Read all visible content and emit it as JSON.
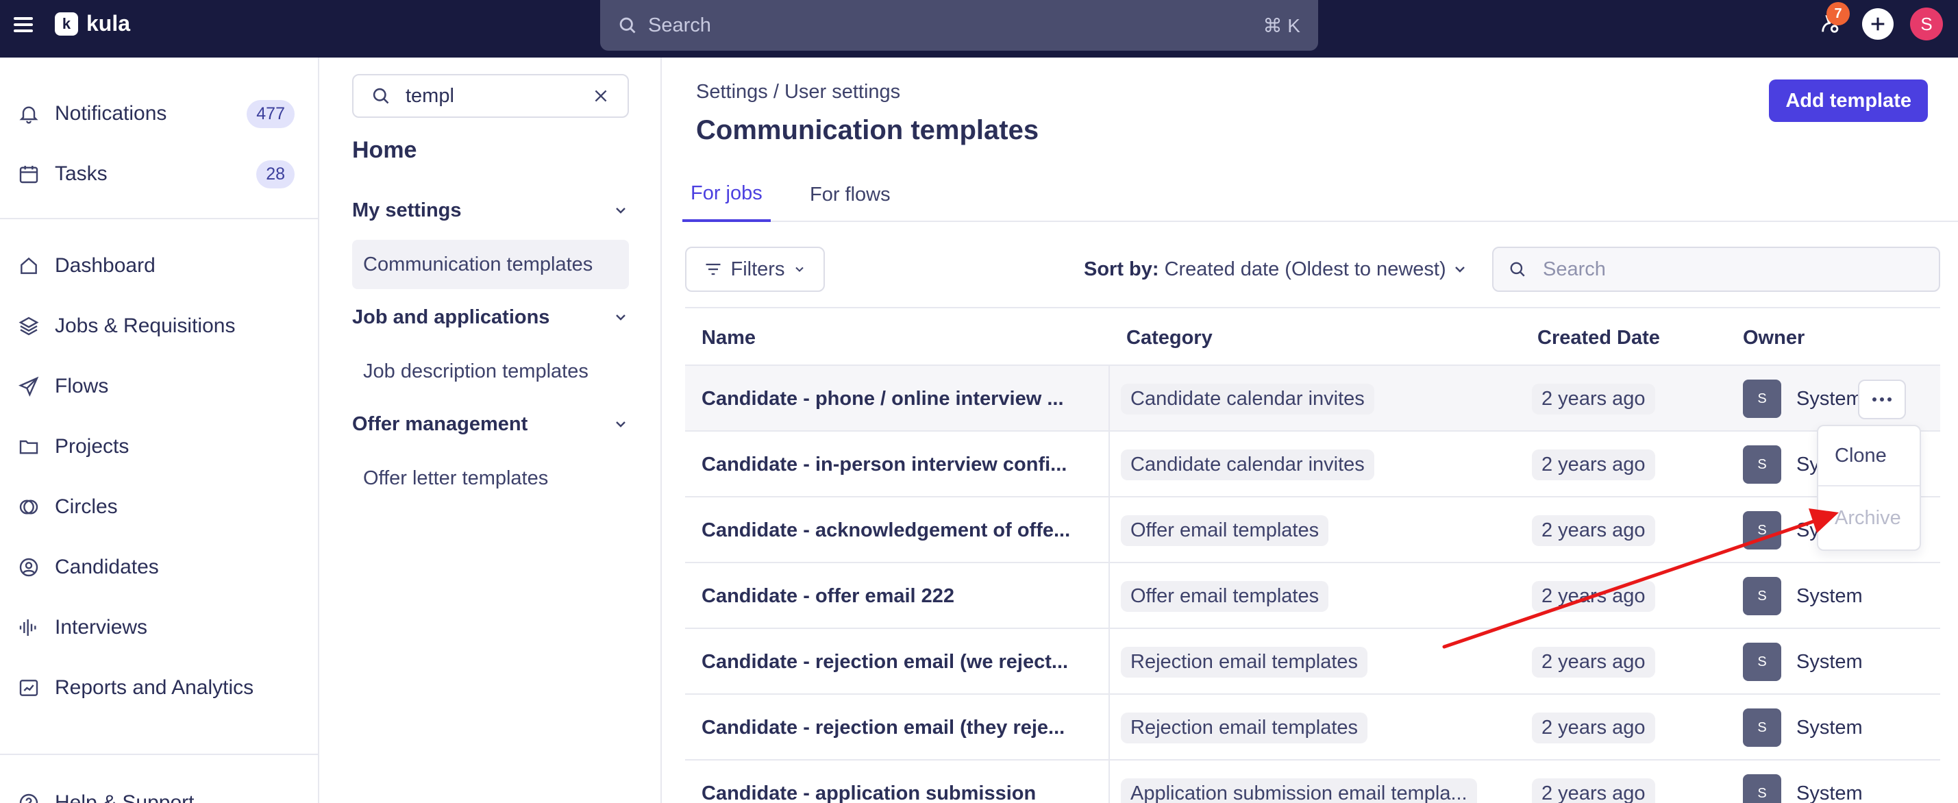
{
  "app": {
    "name": "kula",
    "logo_letter": "k"
  },
  "top_search": {
    "placeholder": "Search",
    "shortcut": "⌘ K"
  },
  "top_right": {
    "notification_count": "7",
    "avatar_initial": "S"
  },
  "sidebar": {
    "top_items": [
      {
        "label": "Notifications",
        "count": "477",
        "icon": "bell-icon"
      },
      {
        "label": "Tasks",
        "count": "28",
        "icon": "calendar-icon"
      }
    ],
    "nav_items": [
      {
        "label": "Dashboard",
        "icon": "home-icon"
      },
      {
        "label": "Jobs & Requisitions",
        "icon": "layers-icon"
      },
      {
        "label": "Flows",
        "icon": "send-icon"
      },
      {
        "label": "Projects",
        "icon": "folder-icon"
      },
      {
        "label": "Circles",
        "icon": "circles-icon"
      },
      {
        "label": "Candidates",
        "icon": "user-circle-icon"
      },
      {
        "label": "Interviews",
        "icon": "audio-wave-icon"
      },
      {
        "label": "Reports and Analytics",
        "icon": "chart-icon"
      }
    ],
    "bottom_item": {
      "label": "Help & Support",
      "icon": "help-icon"
    }
  },
  "settings_panel": {
    "search_value": "templ",
    "title": "Home",
    "sections": [
      {
        "title": "My settings",
        "items": [
          "Communication templates"
        ]
      },
      {
        "title": "Job and applications",
        "items": [
          "Job description templates"
        ]
      },
      {
        "title": "Offer management",
        "items": [
          "Offer letter templates"
        ]
      }
    ]
  },
  "main": {
    "breadcrumb": "Settings / User settings",
    "title": "Communication templates",
    "add_button": "Add template",
    "tabs": [
      "For jobs",
      "For flows"
    ],
    "filters_label": "Filters",
    "sort_label": "Sort by:",
    "sort_value": "Created date (Oldest to newest)",
    "search_placeholder": "Search",
    "columns": [
      "Name",
      "Category",
      "Created Date",
      "Owner"
    ],
    "rows": [
      {
        "name": "Candidate - phone / online interview ...",
        "category": "Candidate calendar invites",
        "created": "2 years ago",
        "owner": "System",
        "owner_initial": "S"
      },
      {
        "name": "Candidate - in-person interview confi...",
        "category": "Candidate calendar invites",
        "created": "2 years ago",
        "owner": "System",
        "owner_initial": "S"
      },
      {
        "name": "Candidate - acknowledgement of offe...",
        "category": "Offer email templates",
        "created": "2 years ago",
        "owner": "System",
        "owner_initial": "S"
      },
      {
        "name": "Candidate - offer email 222",
        "category": "Offer email templates",
        "created": "2 years ago",
        "owner": "System",
        "owner_initial": "S"
      },
      {
        "name": "Candidate - rejection email (we reject...",
        "category": "Rejection email templates",
        "created": "2 years ago",
        "owner": "System",
        "owner_initial": "S"
      },
      {
        "name": "Candidate - rejection email (they reje...",
        "category": "Rejection email templates",
        "created": "2 years ago",
        "owner": "System",
        "owner_initial": "S"
      },
      {
        "name": "Candidate - application submission",
        "category": "Application submission email templa...",
        "created": "2 years ago",
        "owner": "System",
        "owner_initial": "S"
      }
    ],
    "row_menu": [
      "Clone",
      "Archive"
    ]
  },
  "colors": {
    "accent": "#4b3fe0",
    "topbar": "#181a3f",
    "annotation_arrow": "#e81818"
  }
}
